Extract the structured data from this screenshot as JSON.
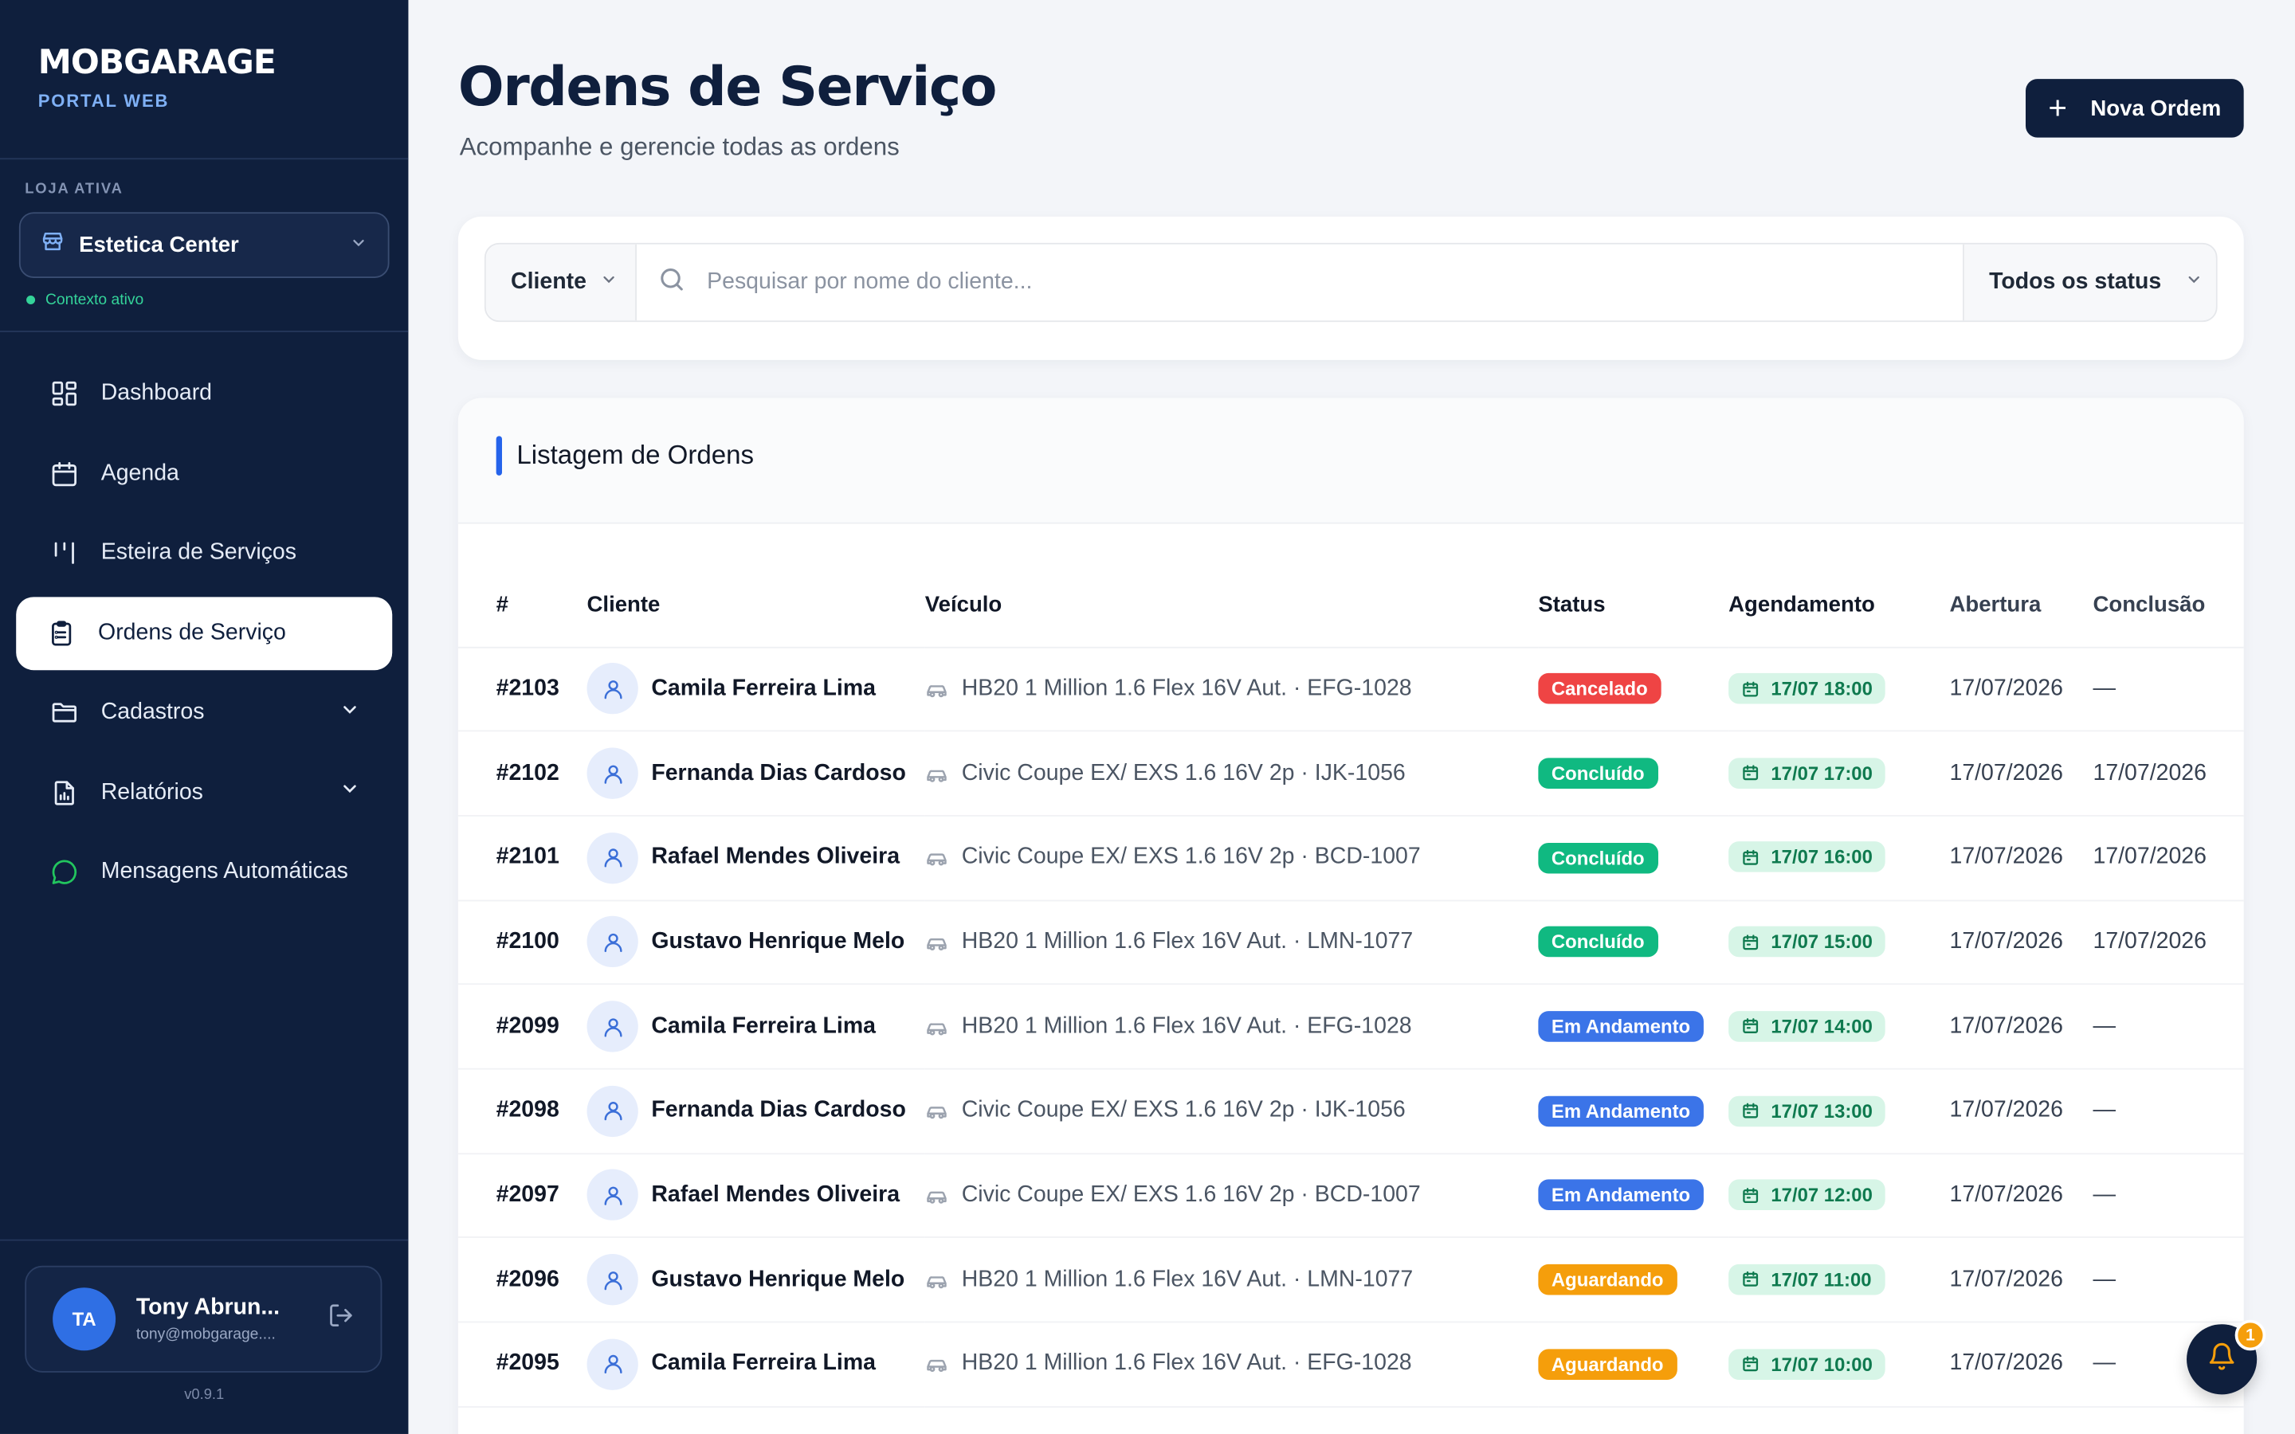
{
  "brand": {
    "title": "MOBGARAGE",
    "subtitle": "PORTAL WEB"
  },
  "store": {
    "label": "LOJA ATIVA",
    "name": "Estetica Center",
    "context": "Contexto ativo"
  },
  "nav": [
    {
      "label": "Dashboard",
      "icon": "dashboard-icon"
    },
    {
      "label": "Agenda",
      "icon": "calendar-icon"
    },
    {
      "label": "Esteira de Serviços",
      "icon": "kanban-icon"
    },
    {
      "label": "Ordens de Serviço",
      "icon": "clipboard-icon",
      "active": true
    },
    {
      "label": "Cadastros",
      "icon": "folder-icon",
      "expandable": true
    },
    {
      "label": "Relatórios",
      "icon": "report-icon",
      "expandable": true
    },
    {
      "label": "Mensagens Automáticas",
      "icon": "message-icon"
    }
  ],
  "user": {
    "initials": "TA",
    "name": "Tony Abrun...",
    "email": "tony@mobgarage...."
  },
  "version": "v0.9.1",
  "page": {
    "title": "Ordens de Serviço",
    "subtitle": "Acompanhe e gerencie todas as ordens",
    "new_button": "Nova Ordem"
  },
  "filters": {
    "type": "Cliente",
    "search_placeholder": "Pesquisar por nome do cliente...",
    "search_value": "",
    "status": "Todos os status"
  },
  "list": {
    "title": "Listagem de Ordens",
    "columns": [
      "#",
      "Cliente",
      "Veículo",
      "Status",
      "Agendamento",
      "Abertura",
      "Conclusão"
    ],
    "rows": [
      {
        "id": "#2103",
        "client": "Camila Ferreira Lima",
        "vehicle": "HB20 1 Million 1.6 Flex 16V Aut. · EFG-1028",
        "status": "Cancelado",
        "schedule": "17/07 18:00",
        "opened": "17/07/2026",
        "closed": "—"
      },
      {
        "id": "#2102",
        "client": "Fernanda Dias Cardoso",
        "vehicle": "Civic Coupe EX/ EXS 1.6 16V 2p · IJK-1056",
        "status": "Concluído",
        "schedule": "17/07 17:00",
        "opened": "17/07/2026",
        "closed": "17/07/2026"
      },
      {
        "id": "#2101",
        "client": "Rafael Mendes Oliveira",
        "vehicle": "Civic Coupe EX/ EXS 1.6 16V 2p · BCD-1007",
        "status": "Concluído",
        "schedule": "17/07 16:00",
        "opened": "17/07/2026",
        "closed": "17/07/2026"
      },
      {
        "id": "#2100",
        "client": "Gustavo Henrique Melo",
        "vehicle": "HB20 1 Million 1.6 Flex 16V Aut. · LMN-1077",
        "status": "Concluído",
        "schedule": "17/07 15:00",
        "opened": "17/07/2026",
        "closed": "17/07/2026"
      },
      {
        "id": "#2099",
        "client": "Camila Ferreira Lima",
        "vehicle": "HB20 1 Million 1.6 Flex 16V Aut. · EFG-1028",
        "status": "Em Andamento",
        "schedule": "17/07 14:00",
        "opened": "17/07/2026",
        "closed": "—"
      },
      {
        "id": "#2098",
        "client": "Fernanda Dias Cardoso",
        "vehicle": "Civic Coupe EX/ EXS 1.6 16V 2p · IJK-1056",
        "status": "Em Andamento",
        "schedule": "17/07 13:00",
        "opened": "17/07/2026",
        "closed": "—"
      },
      {
        "id": "#2097",
        "client": "Rafael Mendes Oliveira",
        "vehicle": "Civic Coupe EX/ EXS 1.6 16V 2p · BCD-1007",
        "status": "Em Andamento",
        "schedule": "17/07 12:00",
        "opened": "17/07/2026",
        "closed": "—"
      },
      {
        "id": "#2096",
        "client": "Gustavo Henrique Melo",
        "vehicle": "HB20 1 Million 1.6 Flex 16V Aut. · LMN-1077",
        "status": "Aguardando",
        "schedule": "17/07 11:00",
        "opened": "17/07/2026",
        "closed": "—"
      },
      {
        "id": "#2095",
        "client": "Camila Ferreira Lima",
        "vehicle": "HB20 1 Million 1.6 Flex 16V Aut. · EFG-1028",
        "status": "Aguardando",
        "schedule": "17/07 10:00",
        "opened": "17/07/2026",
        "closed": "—"
      }
    ]
  },
  "status_colors": {
    "Cancelado": "#ef4444",
    "Concluído": "#10b981",
    "Em Andamento": "#3b74e8",
    "Aguardando": "#f59e0b"
  },
  "notifications": {
    "count": "1"
  }
}
